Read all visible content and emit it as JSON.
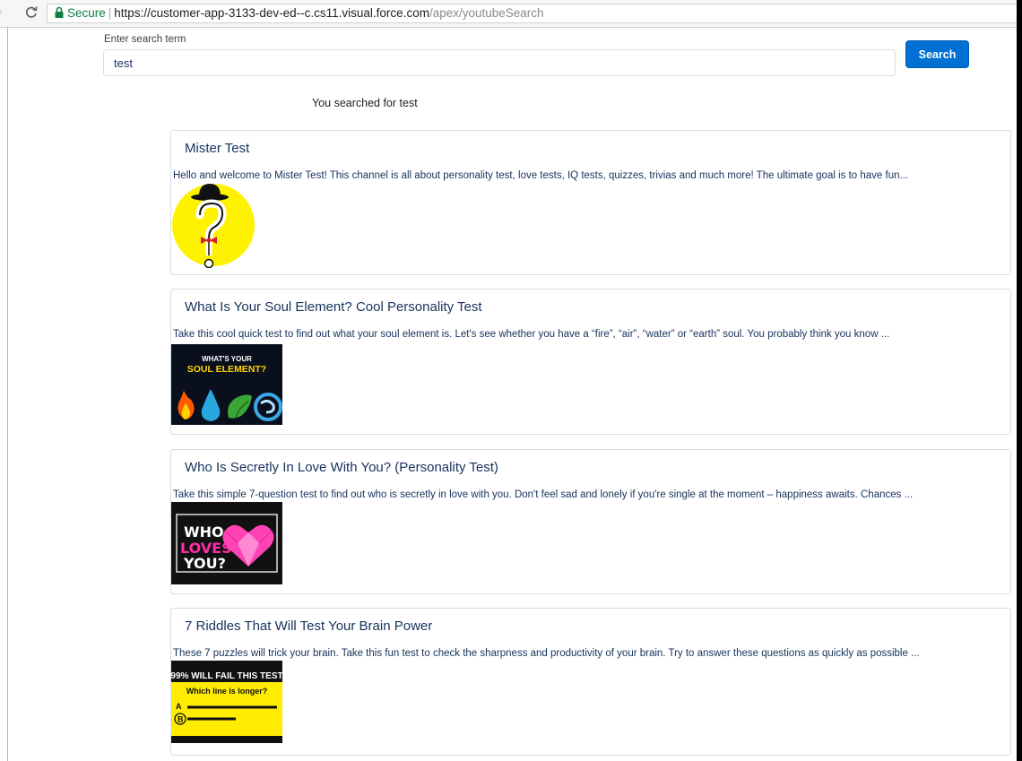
{
  "browser": {
    "secure_label": "Secure",
    "url_main": "https://customer-app-3133-dev-ed--c.cs11.visual.force.com",
    "url_path": "/apex/youtubeSearch"
  },
  "search": {
    "label": "Enter search term",
    "value": "test",
    "button_label": "Search",
    "result_text": "You searched for test"
  },
  "results": [
    {
      "title": "Mister Test",
      "description": "Hello and welcome to Mister Test! This channel is all about personality test, love tests, IQ tests, quizzes, trivias and much more! The ultimate goal is to have fun..."
    },
    {
      "title": "What Is Your Soul Element? Cool Personality Test",
      "description": "Take this cool quick test to find out what your soul element is. Let's see whether you have a “fire”, “air”, “water” or “earth” soul. You probably think you know ...",
      "thumb_text": [
        "WHAT'S YOUR",
        "SOUL ELEMENT?"
      ]
    },
    {
      "title": "Who Is Secretly In Love With You? (Personality Test)",
      "description": "Take this simple 7-question test to find out who is secretly in love with you. Don't feel sad and lonely if you're single at the moment – happiness awaits. Chances ...",
      "thumb_text": [
        "WHO",
        "LOVES",
        "YOU?"
      ]
    },
    {
      "title": "7 Riddles That Will Test Your Brain Power",
      "description": "These 7 puzzles will trick your brain. Take this fun test to check the sharpness and productivity of your brain. Try to answer these questions as quickly as possible ...",
      "thumb_text": [
        "99% WILL FAIL THIS TEST",
        "Which line is longer?",
        "A",
        "B"
      ]
    }
  ],
  "colors": {
    "primary_button": "#0070d2",
    "secure_green": "#0b8043",
    "title_text": "#16325c"
  }
}
